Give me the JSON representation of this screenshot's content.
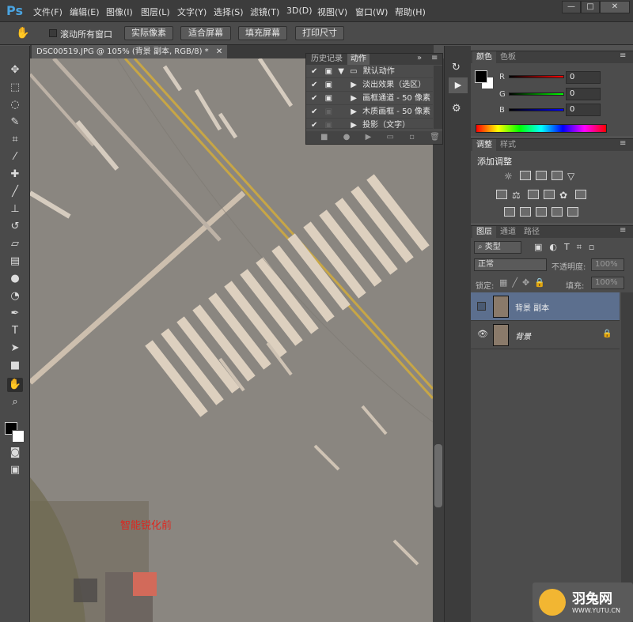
{
  "app": {
    "logo": "Ps"
  },
  "menu": [
    "文件(F)",
    "编辑(E)",
    "图像(I)",
    "图层(L)",
    "文字(Y)",
    "选择(S)",
    "滤镜(T)",
    "3D(D)",
    "视图(V)",
    "窗口(W)",
    "帮助(H)"
  ],
  "window_buttons": {
    "minimize": "—",
    "restore": "□",
    "close": "✕"
  },
  "options_bar": {
    "scroll_all": "滚动所有窗口",
    "buttons": [
      "实际像素",
      "适合屏幕",
      "填充屏幕",
      "打印尺寸"
    ]
  },
  "document": {
    "tab": "DSC00519.JPG @ 105% (背景 副本, RGB/8) *",
    "caption": "智能锐化前",
    "caption_color": "#e0251d"
  },
  "actions_panel": {
    "tabs": [
      "历史记录",
      "动作"
    ],
    "rows": [
      "默认动作",
      "淡出效果（选区）",
      "画框通道 - 50 像素",
      "木质画框 - 50 像素",
      "投影（文字）"
    ]
  },
  "color_panel": {
    "tabs": [
      "颜色",
      "色板"
    ],
    "channels": [
      {
        "label": "R",
        "value": "0"
      },
      {
        "label": "G",
        "value": "0"
      },
      {
        "label": "B",
        "value": "0"
      }
    ]
  },
  "adjust_panel": {
    "tabs": [
      "调整",
      "样式"
    ],
    "title": "添加调整"
  },
  "layers_panel": {
    "tabs": [
      "图层",
      "通道",
      "路径"
    ],
    "filter": "类型",
    "blend": "正常",
    "opacity_label": "不透明度:",
    "opacity_value": "100%",
    "lock_label": "锁定:",
    "fill_label": "填充:",
    "fill_value": "100%",
    "layers": [
      {
        "name": "背景 副本",
        "selected": true,
        "visible": false
      },
      {
        "name": "背景",
        "selected": false,
        "visible": true,
        "locked": true
      }
    ]
  },
  "watermark": {
    "name": "羽兔网",
    "url": "WWW.YUTU.CN"
  }
}
